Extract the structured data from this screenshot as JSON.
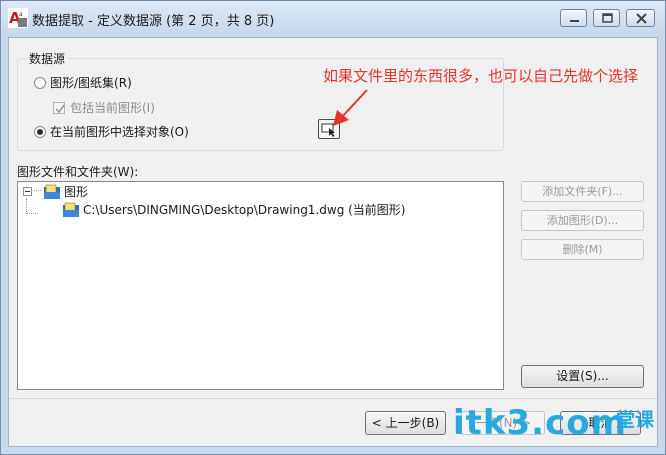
{
  "window": {
    "title": "数据提取 - 定义数据源 (第 2 页，共 8 页)"
  },
  "datasource": {
    "group_title": "数据源",
    "option_drawings": "图形/图纸集(R)",
    "option_include_current": "包括当前图形(I)",
    "option_select_objects": "在当前图形中选择对象(O)",
    "selected_option": "option_select_objects"
  },
  "annotation": {
    "text": "如果文件里的东西很多，也可以自己先做个选择",
    "color": "#e8322c"
  },
  "files": {
    "label": "图形文件和文件夹(W):",
    "tree": [
      {
        "label": "图形",
        "children": [
          {
            "label": "C:\\Users\\DINGMING\\Desktop\\Drawing1.dwg (当前图形)"
          }
        ]
      }
    ]
  },
  "side_buttons": {
    "add_folder": "添加文件夹(F)...",
    "add_drawing": "添加图形(D)...",
    "remove": "删除(M)",
    "settings": "设置(S)..."
  },
  "nav_buttons": {
    "prev": "< 上一步(B)",
    "next": "一步(N) >",
    "cancel": "取消"
  },
  "watermark": {
    "main": "itk3.com",
    "sub": "一堂课"
  },
  "colors": {
    "accent": "#27a9e1",
    "annotation": "#e8322c"
  }
}
